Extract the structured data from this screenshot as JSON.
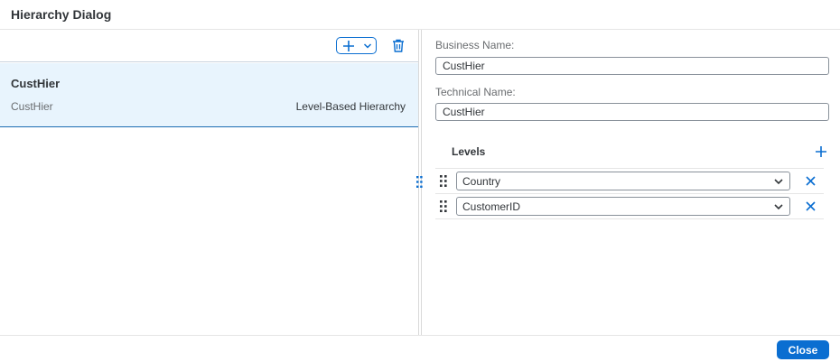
{
  "dialog": {
    "title": "Hierarchy Dialog"
  },
  "toolbar": {
    "add_icon": "plus-icon",
    "menu_icon": "chevron-down-icon",
    "delete_icon": "trash-icon"
  },
  "hierarchies": [
    {
      "name": "CustHier",
      "technical": "CustHier",
      "type": "Level-Based Hierarchy",
      "selected": true
    }
  ],
  "details": {
    "business_name_label": "Business Name:",
    "business_name_value": "CustHier",
    "technical_name_label": "Technical Name:",
    "technical_name_value": "CustHier",
    "levels_title": "Levels",
    "levels": [
      {
        "value": "Country"
      },
      {
        "value": "CustomerID"
      }
    ]
  },
  "footer": {
    "close_label": "Close"
  },
  "colors": {
    "accent": "#0a6ed1",
    "selected_bg": "#e8f4fd",
    "text": "#32363a"
  }
}
